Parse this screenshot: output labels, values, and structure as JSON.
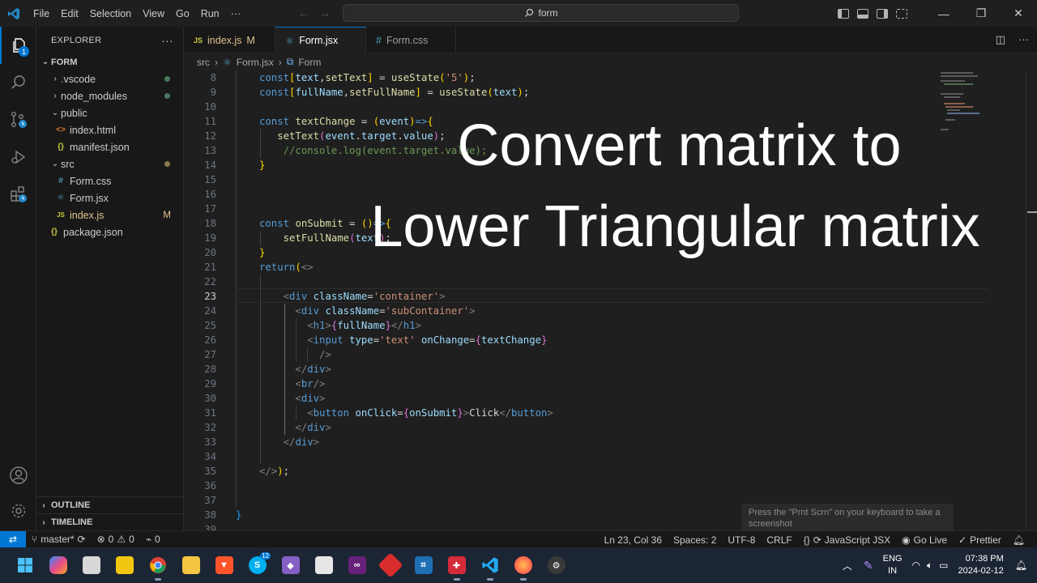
{
  "titlebar": {
    "menu": [
      "File",
      "Edit",
      "Selection",
      "View",
      "Go",
      "Run",
      "···"
    ],
    "search": "form",
    "window_controls": [
      "minimize-icon",
      "restore-icon",
      "close-icon"
    ]
  },
  "activitybar": {
    "items": [
      "explorer-icon",
      "search-icon",
      "source-control-icon",
      "run-debug-icon",
      "extensions-icon"
    ],
    "explorer_badge": "1",
    "bottom": [
      "accounts-icon",
      "manage-gear-icon"
    ]
  },
  "explorer": {
    "title": "EXPLORER",
    "more": "···",
    "root": "FORM",
    "tree": [
      {
        "label": ".vscode",
        "kind": "folder-closed",
        "indent": 1
      },
      {
        "label": "node_modules",
        "kind": "folder-closed",
        "indent": 1
      },
      {
        "label": "public",
        "kind": "folder-open",
        "indent": 1
      },
      {
        "label": "index.html",
        "kind": "html",
        "indent": 2
      },
      {
        "label": "manifest.json",
        "kind": "json",
        "indent": 2
      },
      {
        "label": "src",
        "kind": "folder-open",
        "indent": 1
      },
      {
        "label": "Form.css",
        "kind": "css",
        "indent": 2
      },
      {
        "label": "Form.jsx",
        "kind": "react",
        "indent": 2
      },
      {
        "label": "index.js",
        "kind": "js",
        "indent": 2,
        "flag": "M"
      },
      {
        "label": "package.json",
        "kind": "json",
        "indent": 1
      }
    ],
    "outline": "OUTLINE",
    "timeline": "TIMELINE"
  },
  "tabs": [
    {
      "icon": "JS",
      "label": "index.js",
      "flag": "M",
      "active": false
    },
    {
      "icon": "⚛",
      "label": "Form.jsx",
      "dirty": true,
      "active": true
    },
    {
      "icon": "#",
      "label": "Form.css",
      "active": false
    }
  ],
  "breadcrumb": {
    "folder": "src",
    "file": "Form.jsx",
    "symbol": "Form"
  },
  "editor": {
    "line_numbers": [
      "8",
      "9",
      "10",
      "11",
      "12",
      "13",
      "14",
      "15",
      "16",
      "17",
      "18",
      "19",
      "20",
      "21",
      "22",
      "23",
      "24",
      "25",
      "26",
      "27",
      "28",
      "29",
      "30",
      "31",
      "32",
      "33",
      "34",
      "35",
      "36",
      "37",
      "38",
      "39"
    ],
    "current_line": "23"
  },
  "overlay": {
    "line1": "Convert matrix to",
    "line2": "Lower Triangular matrix"
  },
  "toast": "Press the \"Prnt Scrn\" on your keyboard to take a screenshot",
  "statusbar": {
    "branch": "master*",
    "errors": "0",
    "warnings": "0",
    "ports": "0",
    "position": "Ln 23, Col 36",
    "spaces": "Spaces: 2",
    "encoding": "UTF-8",
    "eol": "CRLF",
    "language": "JavaScript JSX",
    "golive": "Go Live",
    "prettier": "Prettier"
  },
  "taskbar": {
    "apps": [
      "windows-start-icon",
      "copilot-icon",
      "file-explorer-icon",
      "sticky-app-icon",
      "chrome-icon",
      "folder-icon",
      "brave-icon",
      "skype-icon",
      "visual-studio-icon",
      "store-icon",
      "vs-purple-icon",
      "git-app-icon",
      "sourcetree-icon",
      "game-app-icon",
      "vscode-icon",
      "firefox-icon",
      "settings-app-icon"
    ],
    "skype_badge": "12",
    "language": "ENG",
    "region": "IN",
    "time": "07:38 PM",
    "date": "2024-02-12"
  }
}
